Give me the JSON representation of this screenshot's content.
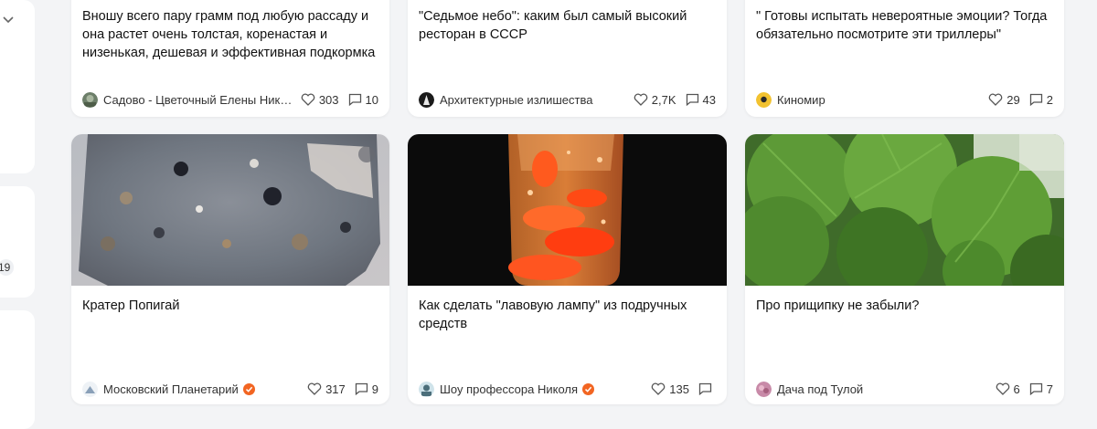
{
  "cards_row1": [
    {
      "title": "Вношу всего пару грамм под любую рассаду и она растет очень толстая, коренастая и низенькая, дешевая и эффективная подкормка",
      "author": "Садово - Цветочный Елены Нико...",
      "likes": "303",
      "comments": "10"
    },
    {
      "title": "\"Седьмое небо\": каким был самый высокий ресторан в СССР",
      "author": "Архитектурные излишества",
      "likes": "2,7K",
      "comments": "43"
    },
    {
      "title": "\" Готовы испытать невероятные эмоции? Тогда обязательно посмотрите эти триллеры\"",
      "author": "Киномир",
      "likes": "29",
      "comments": "2"
    }
  ],
  "cards_row2": [
    {
      "title": "Кратер Попигай",
      "author": "Московский Планетарий",
      "verified": true,
      "likes": "317",
      "comments": "9",
      "image": "meteorite-rock-photo"
    },
    {
      "title": "Как сделать \"лавовую лампу\" из подручных средств",
      "author": "Шоу профессора Николя",
      "verified": true,
      "likes": "135",
      "comments": "",
      "image": "lava-lamp-photo"
    },
    {
      "title": "Про прищипку не забыли?",
      "author": "Дача под Тулой",
      "verified": false,
      "likes": "6",
      "comments": "7",
      "image": "geranium-leaves-photo"
    }
  ],
  "sidebar": {
    "count_badge": "19"
  },
  "colors": {
    "verified": "#f26522",
    "background": "#f3f4f6"
  }
}
